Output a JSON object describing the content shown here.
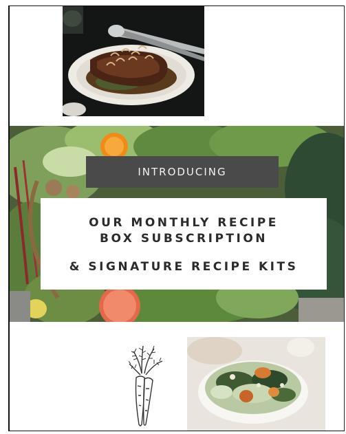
{
  "banner": {
    "intro_label": "INTRODUCING",
    "title_line1": "OUR MONTHLY RECIPE",
    "title_line2": "BOX SUBSCRIPTION",
    "title_line3": "& SIGNATURE RECIPE KITS"
  },
  "icons": {
    "carrot": "carrot-icon"
  },
  "colors": {
    "intro_bg": "#4a4a4b",
    "title_text": "#2b2b2b",
    "page_bg": "#ffffff"
  }
}
